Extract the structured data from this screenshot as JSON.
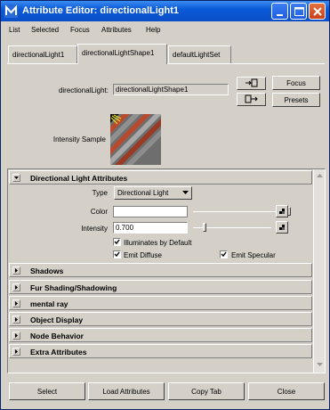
{
  "window": {
    "title": "Attribute Editor: directionalLight1"
  },
  "menu": [
    "List",
    "Selected",
    "Focus",
    "Attributes",
    "Help"
  ],
  "tabs": [
    {
      "label": "directionalLight1",
      "active": false
    },
    {
      "label": "directionalLightShape1",
      "active": true
    },
    {
      "label": "defaultLightSet",
      "active": false
    }
  ],
  "header": {
    "node_label": "directionalLight:",
    "node_value": "directionalLightShape1",
    "focus_label": "Focus",
    "presets_label": "Presets",
    "intensity_sample_label": "Intensity Sample"
  },
  "sections": [
    {
      "label": "Directional Light Attributes",
      "expanded": true
    },
    {
      "label": "Shadows",
      "expanded": false
    },
    {
      "label": "Fur Shading/Shadowing",
      "expanded": false
    },
    {
      "label": "mental ray",
      "expanded": false
    },
    {
      "label": "Object Display",
      "expanded": false
    },
    {
      "label": "Node Behavior",
      "expanded": false
    },
    {
      "label": "Extra Attributes",
      "expanded": false
    }
  ],
  "attributes": {
    "type_label": "Type",
    "type_value": "Directional Light",
    "color_label": "Color",
    "color_hex": "#ffffff",
    "intensity_label": "Intensity",
    "intensity_value": "0.700",
    "illuminates_by_default": {
      "label": "Illuminates by Default",
      "checked": true
    },
    "emit_diffuse": {
      "label": "Emit Diffuse",
      "checked": true
    },
    "emit_specular": {
      "label": "Emit Specular",
      "checked": true
    }
  },
  "bottom_buttons": [
    "Select",
    "Load Attributes",
    "Copy Tab",
    "Close"
  ]
}
